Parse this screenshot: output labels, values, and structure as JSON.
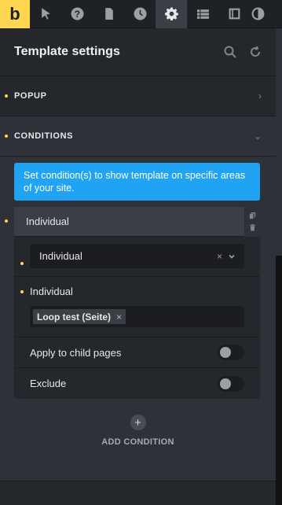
{
  "toolbar": {
    "logo_letter": "b",
    "items": [
      {
        "icon": "cursor-icon"
      },
      {
        "icon": "help-icon"
      },
      {
        "icon": "page-icon"
      },
      {
        "icon": "history-icon"
      },
      {
        "icon": "settings-icon",
        "active": true
      },
      {
        "icon": "grid-icon"
      },
      {
        "icon": "layout-icon"
      },
      {
        "icon": "contrast-icon"
      }
    ]
  },
  "header": {
    "title": "Template settings"
  },
  "sections": {
    "popup": {
      "label": "POPUP"
    },
    "conditions": {
      "label": "CONDITIONS"
    }
  },
  "conditions": {
    "info_text": "Set condition(s) to show template on specific areas of your site.",
    "card_title": "Individual",
    "select_value": "Individual",
    "field_label": "Individual",
    "tag_value": "Loop test (Seite)",
    "tag_remove": "×",
    "apply_child_label": "Apply to child pages",
    "exclude_label": "Exclude",
    "apply_child_enabled": false,
    "exclude_enabled": false,
    "add_label": "ADD CONDITION"
  },
  "colors": {
    "accent": "#ffd64f",
    "info": "#1fa3f2",
    "panel": "#24272c"
  }
}
